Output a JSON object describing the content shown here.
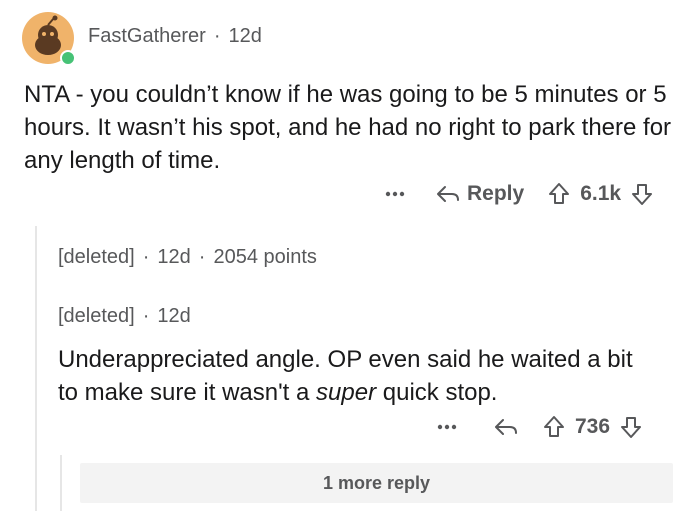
{
  "comment": {
    "author": "FastGatherer",
    "age": "12d",
    "body": "NTA - you couldn’t know if he was going to be 5 minutes or 5 hours. It wasn’t his spot, and he had no right to park there for any length of time.",
    "actions": {
      "more_icon": "ellipsis-icon",
      "reply_label": "Reply",
      "score": "6.1k"
    }
  },
  "deleted_comment": {
    "author": "[deleted]",
    "age": "12d",
    "points": "2054 points"
  },
  "reply": {
    "author": "[deleted]",
    "age": "12d",
    "body_before": "Underappreciated angle.  OP even said he waited a bit to make sure it wasn't a ",
    "body_emphasis": "super",
    "body_after": " quick stop.",
    "score": "736"
  },
  "more_replies_label": "1 more reply",
  "colors": {
    "avatar_bg": "#f0b36a",
    "online": "#46c276",
    "meta_text": "#57585a",
    "thread_line": "#e6e6e6"
  }
}
